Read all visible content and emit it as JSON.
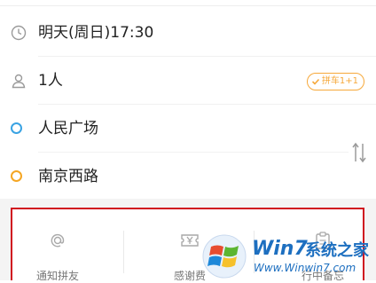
{
  "trip": {
    "time": "明天(周日)17:30",
    "passengers": "1人",
    "carpool_badge": "拼车1+1",
    "origin": "人民广场",
    "destination": "南京西路"
  },
  "actions": [
    {
      "label": "通知拼友",
      "icon": "at-icon"
    },
    {
      "label": "感谢费",
      "icon": "yen-ticket-icon"
    },
    {
      "label": "行中备忘",
      "icon": "clipboard-icon"
    }
  ],
  "watermark": {
    "brand": "Win7",
    "text": "系统之家",
    "url": "Www.Winwin7.com"
  },
  "colors": {
    "origin_dot": "#3aa3e3",
    "destination_dot": "#f5a623",
    "badge": "#f6a83a",
    "highlight_border": "#d0121f"
  }
}
